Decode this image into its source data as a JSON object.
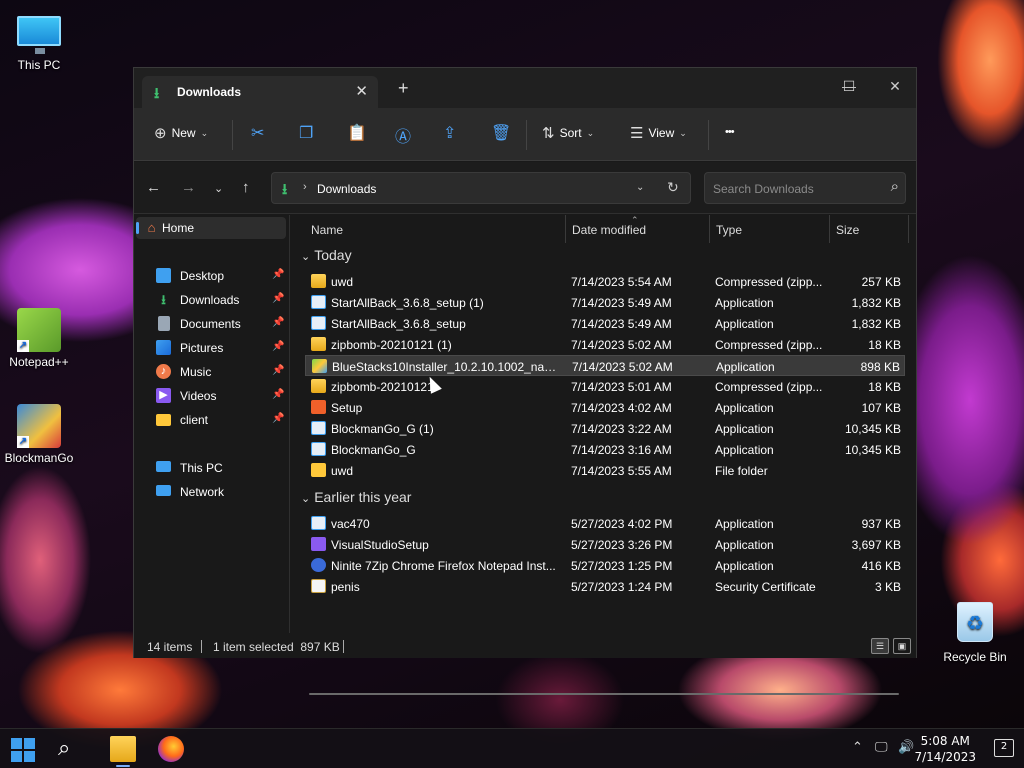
{
  "desktop": {
    "icons": [
      {
        "label": "This PC"
      },
      {
        "label": "Notepad++"
      },
      {
        "label": "BlockmanGo"
      },
      {
        "label": "Recycle Bin"
      }
    ]
  },
  "window": {
    "tab_title": "Downloads",
    "window_controls": {
      "minimize": "—",
      "maximize": "☐",
      "close": "✕"
    },
    "toolbar": {
      "new_label": "New",
      "sort_label": "Sort",
      "view_label": "View",
      "more_label": "•••"
    },
    "address": {
      "crumb": "Downloads",
      "search_placeholder": "Search Downloads"
    },
    "sidebar": {
      "home": "Home",
      "quick": [
        {
          "label": "Desktop",
          "icon": "desktop-icon",
          "color": "#3fa0f0"
        },
        {
          "label": "Downloads",
          "icon": "downloads-icon",
          "color": "#3fbf6f"
        },
        {
          "label": "Documents",
          "icon": "documents-icon",
          "color": "#9aa7b5"
        },
        {
          "label": "Pictures",
          "icon": "pictures-icon",
          "color": "#3fa0f0"
        },
        {
          "label": "Music",
          "icon": "music-icon",
          "color": "#f07a4a"
        },
        {
          "label": "Videos",
          "icon": "videos-icon",
          "color": "#8a5af0"
        },
        {
          "label": "client",
          "icon": "folder-icon",
          "color": "#ffc83a"
        }
      ],
      "this_pc": "This PC",
      "network": "Network"
    },
    "columns": {
      "name": "Name",
      "date": "Date modified",
      "type": "Type",
      "size": "Size"
    },
    "groups": [
      {
        "title": "Today",
        "files": [
          {
            "name": "uwd",
            "date": "7/14/2023 5:54 AM",
            "type": "Compressed (zipp...",
            "size": "257 KB",
            "icon": "zip-folder-icon",
            "selected": false
          },
          {
            "name": "StartAllBack_3.6.8_setup (1)",
            "date": "7/14/2023 5:49 AM",
            "type": "Application",
            "size": "1,832 KB",
            "icon": "app-icon",
            "selected": false
          },
          {
            "name": "StartAllBack_3.6.8_setup",
            "date": "7/14/2023 5:49 AM",
            "type": "Application",
            "size": "1,832 KB",
            "icon": "app-icon",
            "selected": false
          },
          {
            "name": "zipbomb-20210121 (1)",
            "date": "7/14/2023 5:02 AM",
            "type": "Compressed (zipp...",
            "size": "18 KB",
            "icon": "zip-folder-icon",
            "selected": false
          },
          {
            "name": "BlueStacks10Installer_10.2.10.1002_native...",
            "date": "7/14/2023 5:02 AM",
            "type": "Application",
            "size": "898 KB",
            "icon": "bluestacks-icon",
            "selected": true
          },
          {
            "name": "zipbomb-20210121",
            "date": "7/14/2023 5:01 AM",
            "type": "Compressed (zipp...",
            "size": "18 KB",
            "icon": "zip-folder-icon",
            "selected": false
          },
          {
            "name": "Setup",
            "date": "7/14/2023 4:02 AM",
            "type": "Application",
            "size": "107 KB",
            "icon": "setup-icon",
            "selected": false
          },
          {
            "name": "BlockmanGo_G (1)",
            "date": "7/14/2023 3:22 AM",
            "type": "Application",
            "size": "10,345 KB",
            "icon": "app-icon",
            "selected": false
          },
          {
            "name": "BlockmanGo_G",
            "date": "7/14/2023 3:16 AM",
            "type": "Application",
            "size": "10,345 KB",
            "icon": "app-icon",
            "selected": false
          },
          {
            "name": "uwd",
            "date": "7/14/2023 5:55 AM",
            "type": "File folder",
            "size": "",
            "icon": "folder-icon",
            "selected": false
          }
        ]
      },
      {
        "title": "Earlier this year",
        "files": [
          {
            "name": "vac470",
            "date": "5/27/2023 4:02 PM",
            "type": "Application",
            "size": "937 KB",
            "icon": "app-icon",
            "selected": false
          },
          {
            "name": "VisualStudioSetup",
            "date": "5/27/2023 3:26 PM",
            "type": "Application",
            "size": "3,697 KB",
            "icon": "visualstudio-icon",
            "selected": false
          },
          {
            "name": "Ninite 7Zip Chrome Firefox Notepad Inst...",
            "date": "5/27/2023 1:25 PM",
            "type": "Application",
            "size": "416 KB",
            "icon": "ninite-icon",
            "selected": false
          },
          {
            "name": "penis",
            "date": "5/27/2023 1:24 PM",
            "type": "Security Certificate",
            "size": "3 KB",
            "icon": "certificate-icon",
            "selected": false
          }
        ]
      }
    ],
    "status": {
      "items": "14 items",
      "selected": "1 item selected  897 KB"
    }
  },
  "taskbar": {
    "time": "5:08 AM",
    "date": "7/14/2023",
    "notifications": "2"
  },
  "colors": {
    "accent": "#4fa3f7",
    "selection": "#3a3a3a",
    "window_bg": "#191919"
  }
}
